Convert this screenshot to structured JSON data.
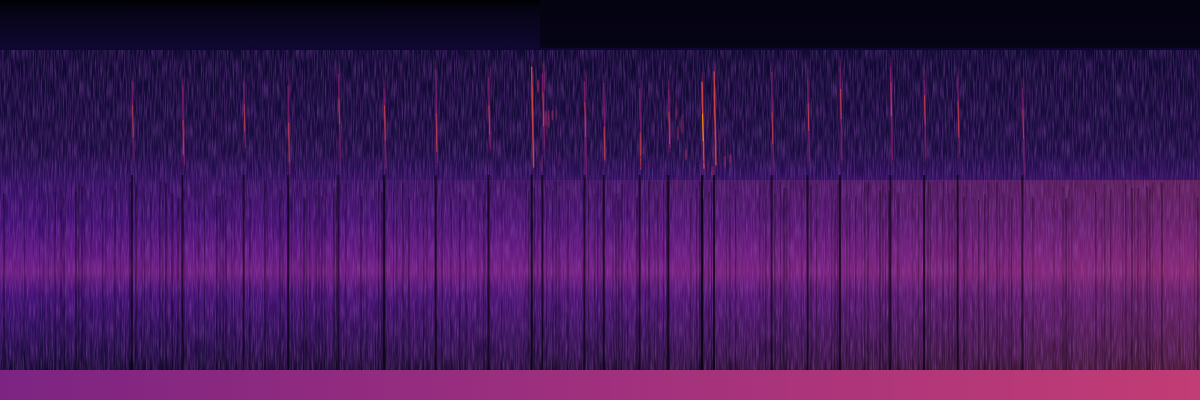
{
  "image": {
    "kind": "spectrogram",
    "colormap": "magma",
    "colors": {
      "background": "#000004",
      "deep_purple": "#1b0c41",
      "purple": "#4a0c6b",
      "magenta": "#781c6d",
      "pink": "#a52c60",
      "hot": "#cf4446",
      "highlight": "#fb9b06"
    },
    "calls": [
      {
        "t": 0.11,
        "strength": 0.55
      },
      {
        "t": 0.152,
        "strength": 0.7
      },
      {
        "t": 0.203,
        "strength": 0.6
      },
      {
        "t": 0.24,
        "strength": 0.6
      },
      {
        "t": 0.282,
        "strength": 0.55
      },
      {
        "t": 0.32,
        "strength": 0.8
      },
      {
        "t": 0.363,
        "strength": 0.7
      },
      {
        "t": 0.407,
        "strength": 0.75
      },
      {
        "t": 0.443,
        "strength": 0.9
      },
      {
        "t": 0.452,
        "strength": 0.85
      },
      {
        "t": 0.487,
        "strength": 0.75
      },
      {
        "t": 0.503,
        "strength": 0.8
      },
      {
        "t": 0.533,
        "strength": 0.75
      },
      {
        "t": 0.557,
        "strength": 0.85
      },
      {
        "t": 0.585,
        "strength": 1.0
      },
      {
        "t": 0.595,
        "strength": 0.9
      },
      {
        "t": 0.643,
        "strength": 0.65
      },
      {
        "t": 0.673,
        "strength": 0.8
      },
      {
        "t": 0.7,
        "strength": 0.8
      },
      {
        "t": 0.742,
        "strength": 0.8
      },
      {
        "t": 0.77,
        "strength": 0.75
      },
      {
        "t": 0.798,
        "strength": 0.65
      },
      {
        "t": 0.852,
        "strength": 0.55
      }
    ]
  }
}
